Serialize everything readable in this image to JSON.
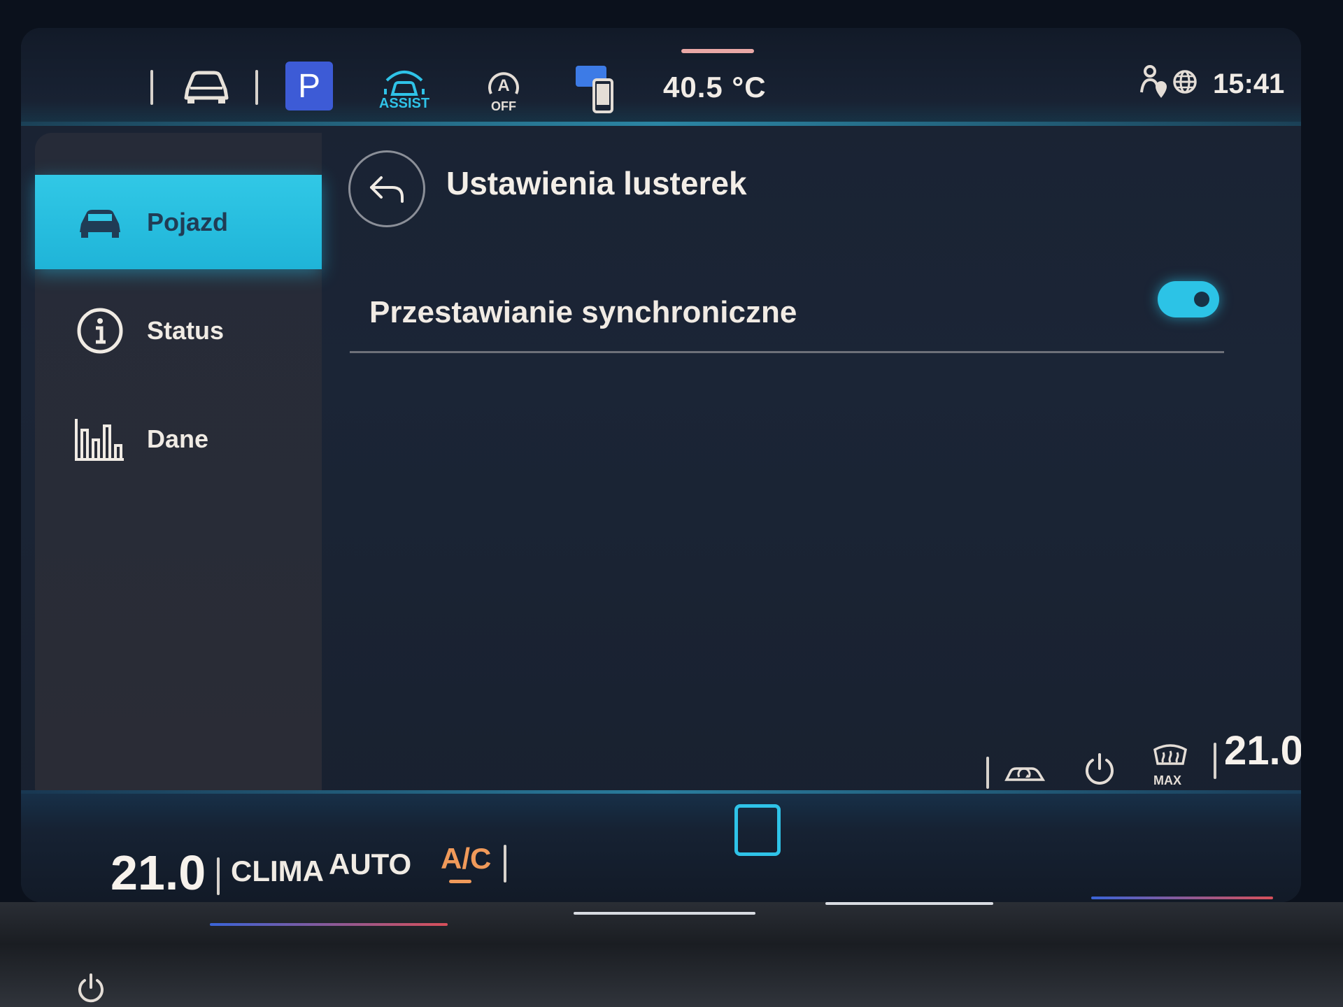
{
  "topbar": {
    "apps_icon": "apps-grid-icon",
    "vehicle_icon": "car-icon",
    "park_label": "P",
    "assist_label": "ASSIST",
    "auto_off_label": "OFF",
    "outside_temp": "40.5 °C",
    "clock": "15:41"
  },
  "sidebar": {
    "items": [
      {
        "label": "Pojazd",
        "icon": "car-icon",
        "active": true
      },
      {
        "label": "Status",
        "icon": "info-icon",
        "active": false
      },
      {
        "label": "Dane",
        "icon": "bar-chart-icon",
        "active": false
      }
    ]
  },
  "main": {
    "title": "Ustawienia lusterek",
    "settings": [
      {
        "label": "Przestawianie synchroniczne",
        "enabled": true
      }
    ]
  },
  "climate": {
    "driver_temp": "21.0",
    "passenger_temp": "21.0",
    "clima_label": "CLIMA",
    "auto_label": "AUTO",
    "ac_label": "A/C",
    "defrost_label": "MAX"
  },
  "colors": {
    "accent": "#2fc3e8",
    "park_blue": "#3d5bd6",
    "ac_orange": "#f09a5a",
    "background": "#1b2536"
  }
}
